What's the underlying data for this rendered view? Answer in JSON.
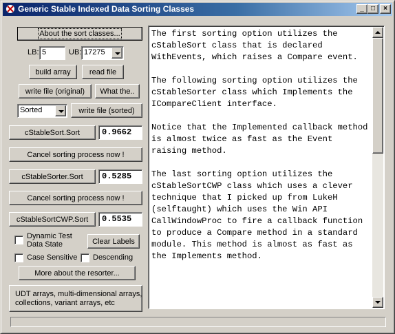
{
  "window": {
    "title": "Generic Stable Indexed Data Sorting Classes",
    "minimize_glyph": "_",
    "maximize_glyph": "□",
    "close_glyph": "×"
  },
  "controls": {
    "about_button": "About the sort classes...",
    "lb_label": "LB:",
    "lb_value": "5",
    "ub_label": "UB:",
    "ub_value": "17275",
    "build_array_button": "build array",
    "read_file_button": "read file",
    "write_file_original_button": "write file (original)",
    "what_the_button": "What the..",
    "sort_state_value": "Sorted",
    "write_file_sorted_button": "write file (sorted)",
    "cstablesort_button": "cStableSort.Sort",
    "cstablesort_time": "0.9662",
    "cancel_button_1": "Cancel sorting process now !",
    "cstablesorter_button": "cStableSorter.Sort",
    "cstablesorter_time": "0.5285",
    "cancel_button_2": "Cancel sorting process now !",
    "cstablesortcwp_button": "cStableSortCWP.Sort",
    "cstablesortcwp_time": "0.5535",
    "dynamic_test_label": "Dynamic Test\nData State",
    "dynamic_test_checked": false,
    "clear_labels_button": "Clear Labels",
    "case_sensitive_label": "Case Sensitive",
    "case_sensitive_checked": false,
    "descending_label": "Descending",
    "descending_checked": false,
    "more_resorter_button": "More about the resorter...",
    "udt_button": "UDT arrays, multi-dimensional arrays,\ncollections, variant arrays, etc"
  },
  "info_text": "The first sorting option utilizes the cStableSort class that is declared WithEvents, which raises a Compare event.\n\nThe following sorting option utilizes the cStableSorter class which Implements the ICompareClient interface.\n\nNotice that the Implemented callback method is almost twice as fast as the Event raising method.\n\nThe last sorting option utilizes the cStableSortCWP class which uses a clever technique that I picked up from LukeH (selftaught) which uses the Win API CallWindowProc to fire a callback function to produce a Compare method in a standard module. This method is almost as fast as the Implements method.",
  "progress": {
    "fraction": 0.0
  },
  "colors": {
    "titlebar_start": "#0a246a",
    "titlebar_end": "#a6caf0",
    "face": "#d4d0c8"
  }
}
